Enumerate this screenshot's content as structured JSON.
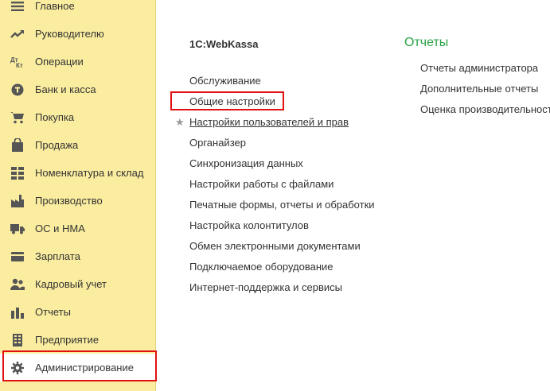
{
  "sidebar": {
    "items": [
      {
        "label": "Главное",
        "icon": "menu-icon"
      },
      {
        "label": "Руководителю",
        "icon": "trend-icon"
      },
      {
        "label": "Операции",
        "icon": "debit-credit-icon"
      },
      {
        "label": "Банк и касса",
        "icon": "coin-icon"
      },
      {
        "label": "Покупка",
        "icon": "cart-icon"
      },
      {
        "label": "Продажа",
        "icon": "bag-icon"
      },
      {
        "label": "Номенклатура и склад",
        "icon": "grid-icon"
      },
      {
        "label": "Производство",
        "icon": "factory-icon"
      },
      {
        "label": "ОС и НМА",
        "icon": "truck-icon"
      },
      {
        "label": "Зарплата",
        "icon": "wallet-icon"
      },
      {
        "label": "Кадровый учет",
        "icon": "people-icon"
      },
      {
        "label": "Отчеты",
        "icon": "bar-chart-icon"
      },
      {
        "label": "Предприятие",
        "icon": "building-icon"
      },
      {
        "label": "Администрирование",
        "icon": "gear-icon"
      }
    ]
  },
  "main": {
    "section_title": "1C:WebKassa",
    "links": [
      "Обслуживание",
      "Общие настройки",
      "Настройки пользователей и прав",
      "Органайзер",
      "Синхронизация данных",
      "Настройки работы с файлами",
      "Печатные формы, отчеты и обработки",
      "Настройка колонтитулов",
      "Обмен электронными документами",
      "Подключаемое оборудование",
      "Интернет-поддержка и сервисы"
    ],
    "star": "★"
  },
  "reports": {
    "title": "Отчеты",
    "links": [
      "Отчеты администратора",
      "Дополнительные отчеты",
      "Оценка производительност"
    ]
  },
  "colors": {
    "sidebar_bg": "#fbeda0",
    "highlight_frame": "#e01010",
    "reports_title": "#2aa347"
  }
}
